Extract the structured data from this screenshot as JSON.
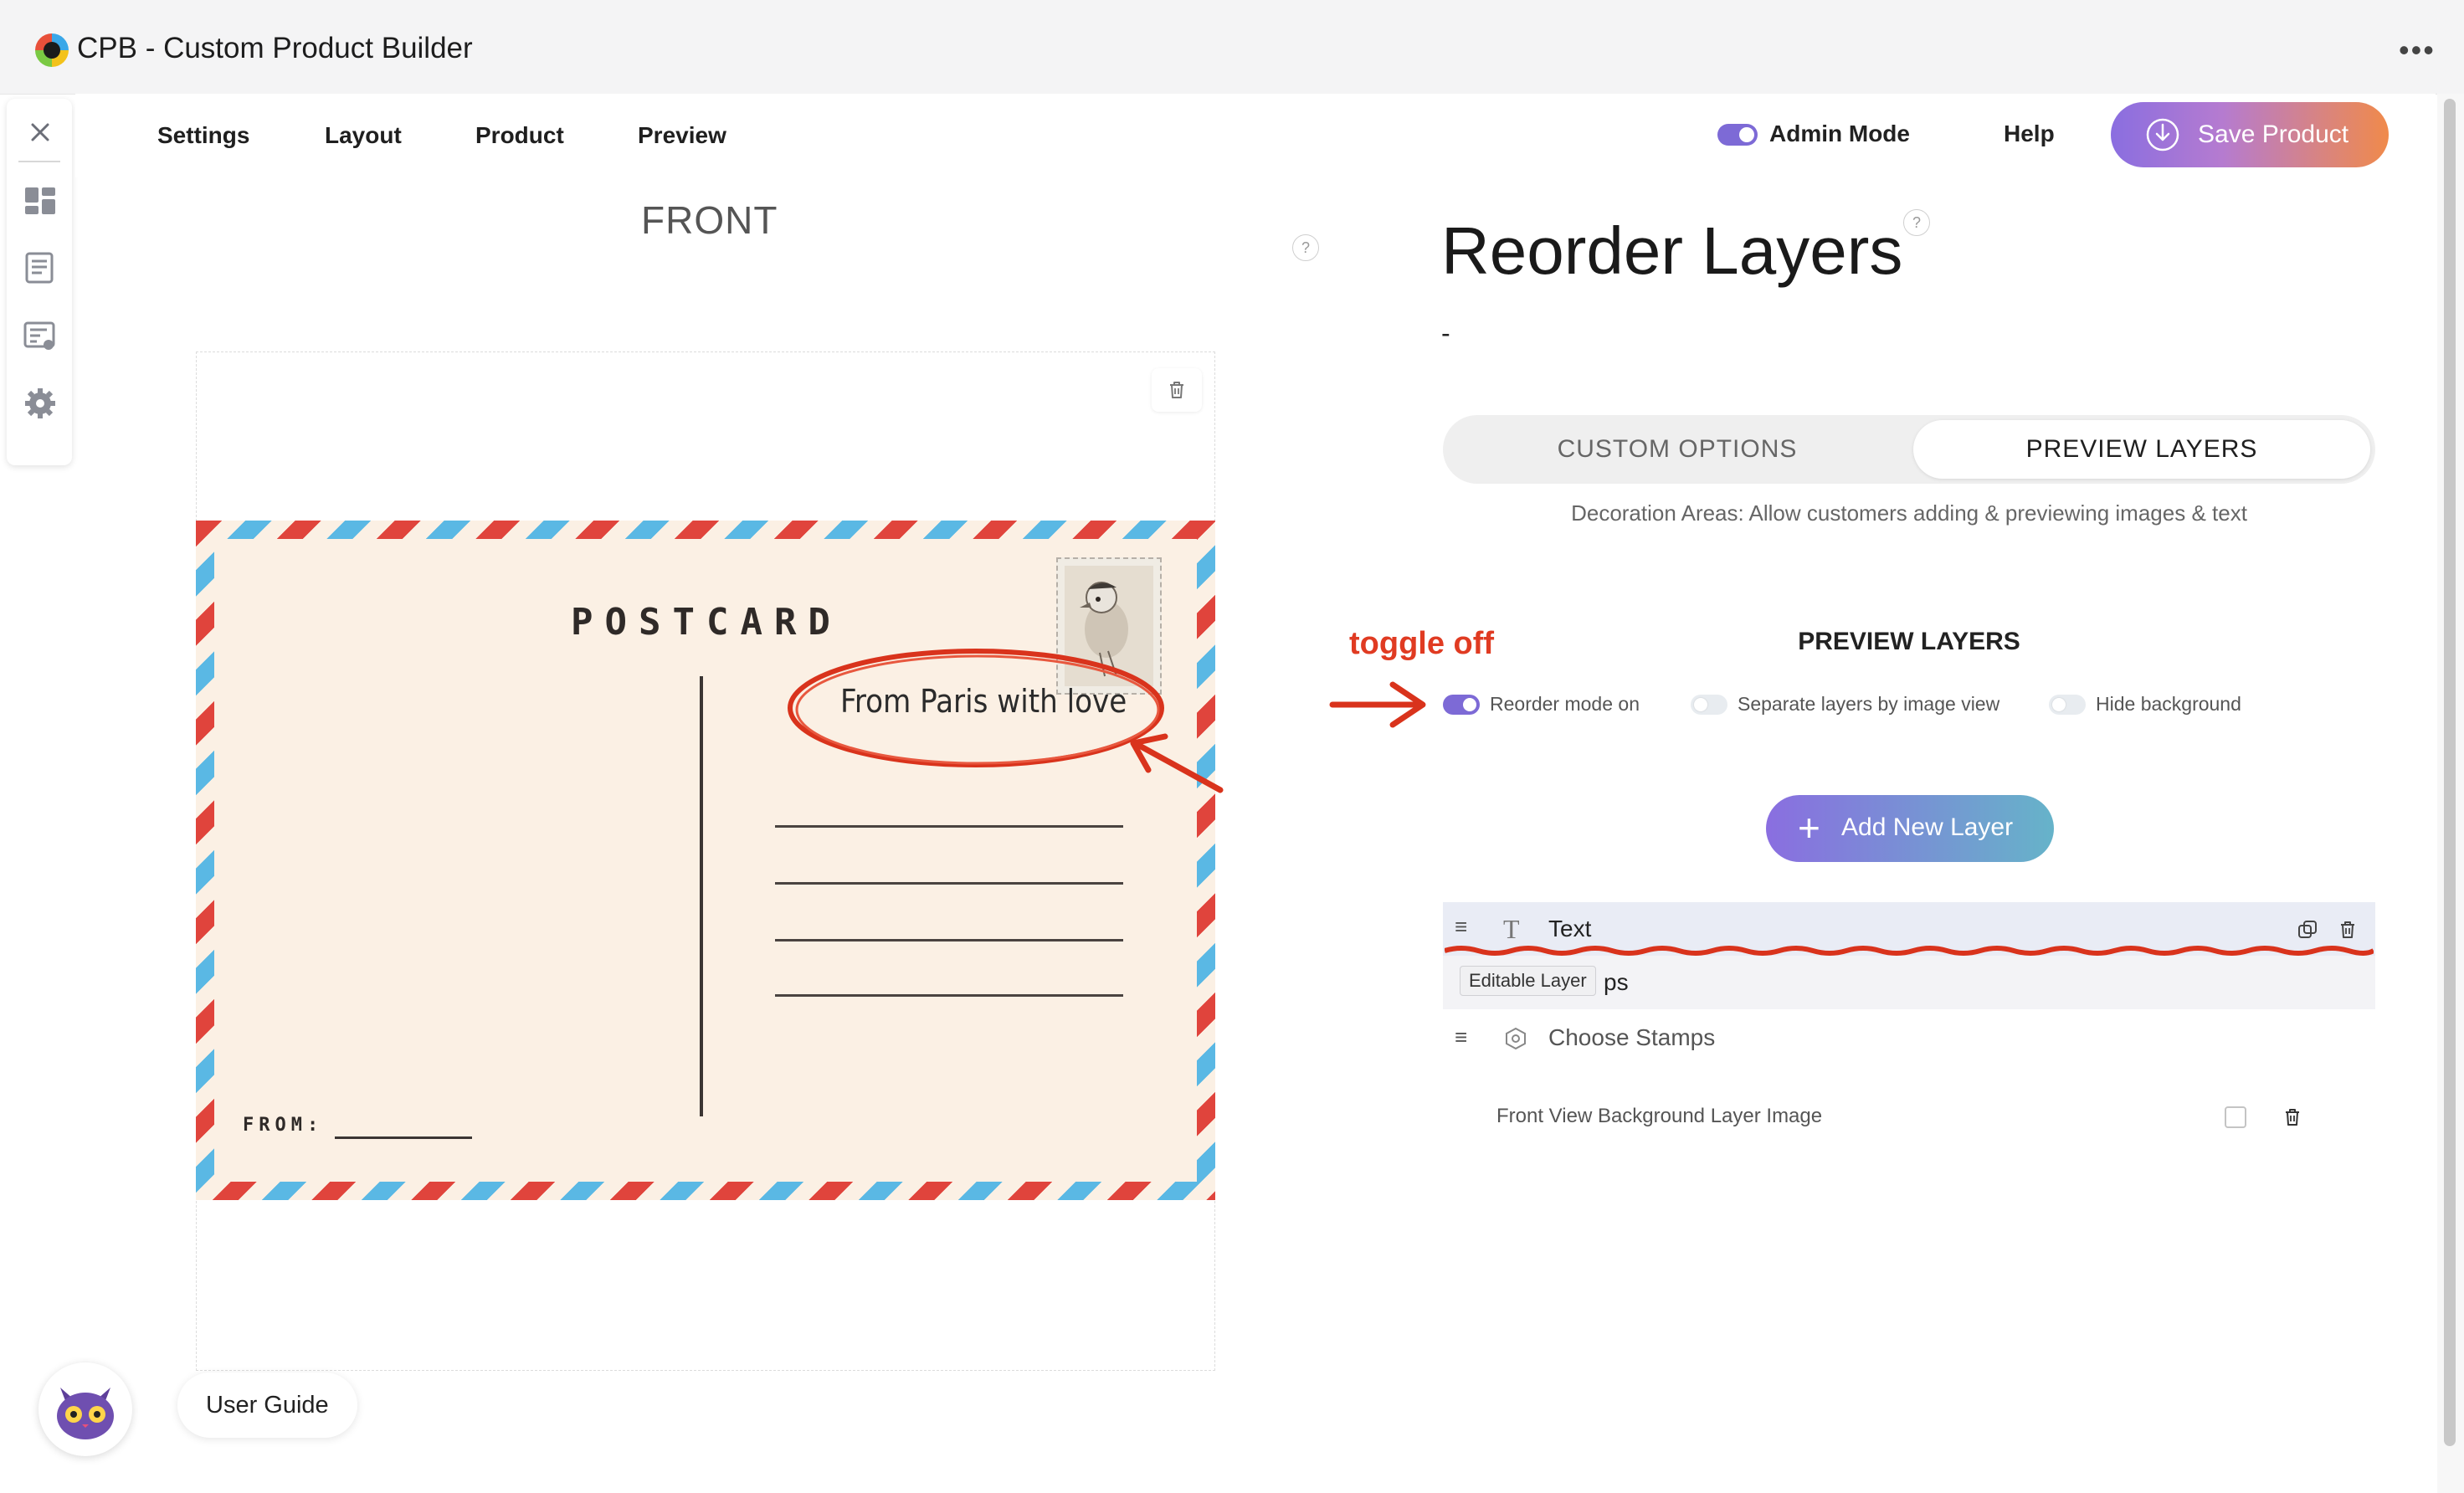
{
  "app": {
    "title": "CPB - Custom Product Builder"
  },
  "nav": {
    "items": [
      {
        "label": "Settings"
      },
      {
        "label": "Layout"
      },
      {
        "label": "Product"
      },
      {
        "label": "Preview"
      }
    ],
    "admin_mode_label": "Admin Mode",
    "admin_mode_on": true,
    "help_label": "Help",
    "save_label": "Save Product"
  },
  "canvas": {
    "view_label": "FRONT",
    "help_glyph": "?",
    "postcard": {
      "heading": "POSTCARD",
      "from_label": "FROM:",
      "editable_text": "From Paris with love"
    }
  },
  "annotations": {
    "toggle_off_note": "toggle off"
  },
  "panel": {
    "title": "Reorder Layers",
    "help_glyph": "?",
    "subtitle": "-",
    "tabs": [
      {
        "label": "CUSTOM OPTIONS",
        "active": false
      },
      {
        "label": "PREVIEW LAYERS",
        "active": true
      }
    ],
    "description": "Decoration Areas: Allow customers adding & previewing images & text",
    "section_heading": "PREVIEW LAYERS",
    "toggles": [
      {
        "label": "Reorder mode on",
        "on": true
      },
      {
        "label": "Separate layers by image view",
        "on": false
      },
      {
        "label": "Hide background",
        "on": false
      }
    ],
    "add_layer_label": "Add New Layer",
    "layers": [
      {
        "name": "Text",
        "icon": "text-icon"
      },
      {
        "name_fragment": "ps",
        "tooltip": "Editable Layer"
      },
      {
        "name": "Choose Stamps",
        "icon": "hexagon-icon"
      }
    ],
    "background_layer_label": "Front View Background Layer Image"
  },
  "bottom": {
    "user_guide_label": "User Guide"
  },
  "colors": {
    "accent_purple": "#7d6ad6",
    "annotation_red": "#e03b22",
    "airmail_red": "#e0443c",
    "airmail_blue": "#5ab8e4"
  }
}
